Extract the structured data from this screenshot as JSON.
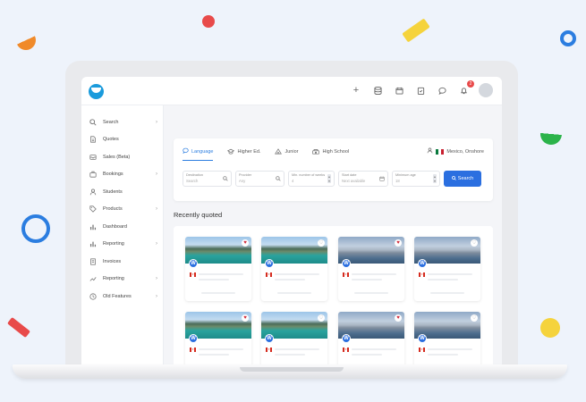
{
  "sidebar": {
    "items": [
      {
        "label": "Search",
        "icon": "search-icon",
        "chevron": true
      },
      {
        "label": "Quotes",
        "icon": "document-icon",
        "chevron": false
      },
      {
        "label": "Sales (Beta)",
        "icon": "inbox-icon",
        "chevron": false
      },
      {
        "label": "Bookings",
        "icon": "briefcase-icon",
        "chevron": true
      },
      {
        "label": "Students",
        "icon": "user-icon",
        "chevron": false
      },
      {
        "label": "Products",
        "icon": "tag-icon",
        "chevron": true
      },
      {
        "label": "Dashboard",
        "icon": "bar-chart-icon",
        "chevron": false
      },
      {
        "label": "Reporting",
        "icon": "bar-chart-icon",
        "chevron": true
      },
      {
        "label": "Invoices",
        "icon": "invoice-icon",
        "chevron": false
      },
      {
        "label": "Reporting",
        "icon": "line-chart-icon",
        "chevron": true
      },
      {
        "label": "Old Features",
        "icon": "clock-icon",
        "chevron": true
      }
    ]
  },
  "topbar": {
    "notification_count": "2"
  },
  "search": {
    "tabs": [
      {
        "label": "Language",
        "icon": "chat-bubble-icon"
      },
      {
        "label": "Higher Ed.",
        "icon": "graduation-cap-icon"
      },
      {
        "label": "Junior",
        "icon": "tent-icon"
      },
      {
        "label": "High School",
        "icon": "school-icon"
      }
    ],
    "location": "Mexico, Onshore",
    "fields": {
      "destination": {
        "label": "Destination",
        "value": "Search"
      },
      "provider": {
        "label": "Provider",
        "value": "Any"
      },
      "weeks": {
        "label": "Min. number of weeks",
        "value": "4"
      },
      "start_date": {
        "label": "Start date",
        "value": "Next available"
      },
      "min_age": {
        "label": "Minimum age",
        "value": "18"
      }
    },
    "button_label": "Search"
  },
  "recent": {
    "title": "Recently quoted",
    "cards": [
      {
        "image": "lake",
        "favorite": true
      },
      {
        "image": "lake",
        "favorite": false
      },
      {
        "image": "city",
        "favorite": true
      },
      {
        "image": "city",
        "favorite": false
      },
      {
        "image": "lake",
        "favorite": true
      },
      {
        "image": "lake",
        "favorite": false
      },
      {
        "image": "city",
        "favorite": true
      },
      {
        "image": "city",
        "favorite": false
      }
    ]
  },
  "colors": {
    "accent": "#2b7de0",
    "button": "#2b6fe0",
    "logo": "#1a9bdc",
    "favorite": "#d02a3a"
  }
}
